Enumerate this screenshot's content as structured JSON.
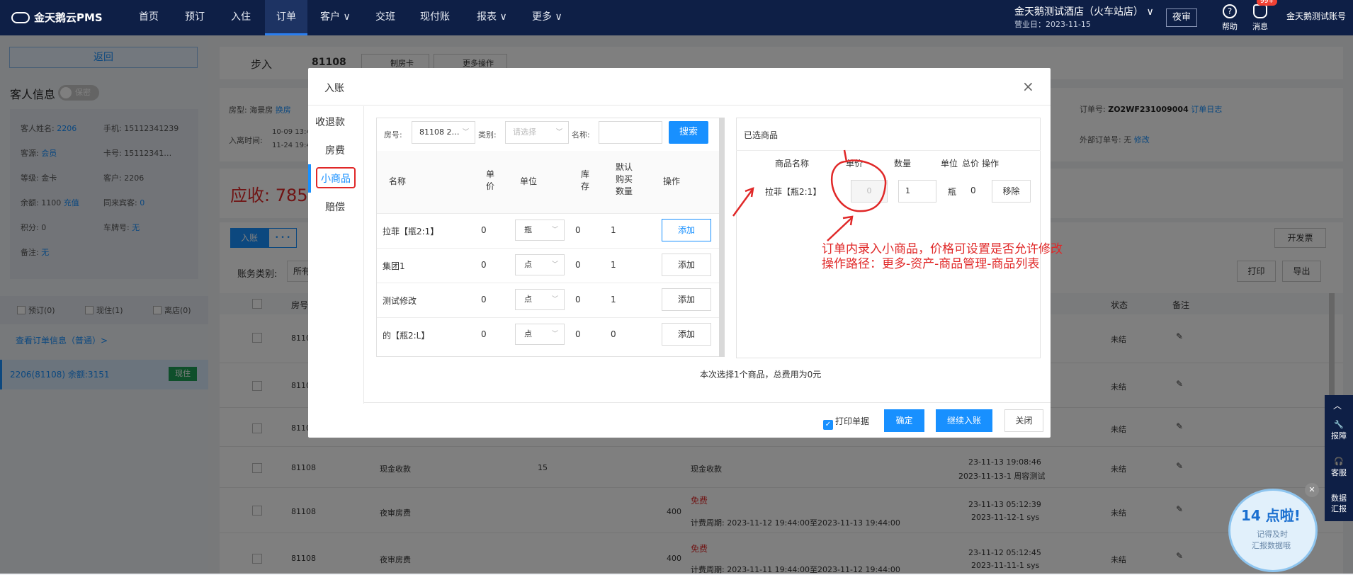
{
  "app": {
    "logo": "金天鹅云PMS",
    "hotel": "金天鹅测试酒店（火车站店）",
    "biz_day": "营业日：2023-11-15",
    "night_audit": "夜审",
    "help": "帮助",
    "messages": "消息",
    "msg_badge": "99+",
    "account": "金天鹅测试账号"
  },
  "nav": [
    {
      "label": "首页"
    },
    {
      "label": "预订"
    },
    {
      "label": "入住"
    },
    {
      "label": "订单"
    },
    {
      "label": "客户 ∨"
    },
    {
      "label": "交班"
    },
    {
      "label": "现付账"
    },
    {
      "label": "报表 ∨"
    },
    {
      "label": "更多 ∨"
    }
  ],
  "left": {
    "back": "返回",
    "guest_title": "客人信息",
    "privacy": "保密",
    "name_label": "客人姓名:",
    "name_value": "2206",
    "phone": "手机: 15112341239",
    "source_label": "客源:",
    "source_value": "会员",
    "card": "卡号: 15112341…",
    "level": "等级: 金卡",
    "customer": "客户: 2206",
    "balance_label": "余额: 1100",
    "recharge": "充值",
    "companions_label": "同来宾客:",
    "companions_value": "0",
    "points": "积分: 0",
    "plate_label": "车牌号:",
    "plate_value": "无",
    "remark_label": "备注:",
    "remark_value": "无",
    "chk_booked": "预订(0)",
    "chk_staying": "现住(1)",
    "chk_left": "离店(0)",
    "view_order": "查看订单信息（普通）>",
    "room_row": "2206(81108)  余额:3151",
    "room_badge": "现住"
  },
  "main": {
    "stepin": "步入",
    "order_no": "81108",
    "make_card": "制房卡",
    "more_ops": "更多操作",
    "room_type": "房型: 海景房",
    "change_room": "换房",
    "stay_time_label": "入离时间:",
    "stay_in": "10-09 13:4",
    "stay_out": "11-24 19:4",
    "order_label": "订单号:",
    "order_value": "ZO2WF231009004",
    "order_log": "订单日志",
    "ext_label": "外部订单号:",
    "ext_value": "无",
    "ext_edit": "修改",
    "receivable": "应收: 785",
    "post_btn": "入账",
    "more_dots": "• • •",
    "invoice": "开发票",
    "print": "打印",
    "export": "导出",
    "acct_type": "账务类别:",
    "acct_value": "所有",
    "col_room": "房号",
    "col_status": "状态",
    "col_remark": "备注"
  },
  "rows": [
    {
      "room": "8110",
      "item": "",
      "amount": "",
      "desc": "",
      "plan": "",
      "time": "",
      "op": "",
      "status": "未结"
    },
    {
      "room": "8110",
      "item": "",
      "amount": "",
      "desc": "",
      "plan": "",
      "time": "",
      "op": "",
      "status": "未结"
    },
    {
      "room": "8110",
      "item": "",
      "amount": "",
      "desc": "",
      "plan": "",
      "time": "",
      "op": "",
      "status": "未结"
    },
    {
      "room": "81108",
      "item": "现金收款",
      "amount": "15",
      "desc": "现金收款",
      "plan": "",
      "time": "23-11-13 19:08:46",
      "op": "2023-11-13-1 周容测试",
      "status": "未结"
    },
    {
      "room": "81108",
      "item": "夜审房费",
      "amount": "400",
      "desc": "免费",
      "plan": "计费周期: 2023-11-12 19:44:00至2023-11-13 19:44:00",
      "time": "23-11-13 05:12:39",
      "op": "2023-11-12-1 sys",
      "status": "未结"
    },
    {
      "room": "81108",
      "item": "夜审房费",
      "amount": "400",
      "desc": "免费",
      "plan": "计费周期: 2023-11-11 19:44:00至2023-11-12 19:44:00",
      "time": "23-11-12 05:12:45",
      "op": "2023-11-11-1 sys",
      "status": "未结"
    }
  ],
  "modal": {
    "title": "入账",
    "tabs": [
      "收退款",
      "房费",
      "小商品",
      "赔偿"
    ],
    "filters": {
      "room_label": "房号:",
      "room_value": "81108 2…",
      "type_label": "类别:",
      "type_placeholder": "请选择",
      "name_label": "名称:",
      "name_value": "",
      "search": "搜索"
    },
    "columns": {
      "name": "名称",
      "price": "单\n价",
      "unit": "单位",
      "stock": "库\n存",
      "default_qty": "默认\n购买\n数量",
      "op": "操作"
    },
    "items": [
      {
        "name": "拉菲【瓶2:1】",
        "price": "0",
        "unit": "瓶",
        "stock": "0",
        "qty": "1",
        "add": "添加"
      },
      {
        "name": "集团1",
        "price": "0",
        "unit": "点",
        "stock": "0",
        "qty": "1",
        "add": "添加"
      },
      {
        "name": "测试修改",
        "price": "0",
        "unit": "点",
        "stock": "0",
        "qty": "1",
        "add": "添加"
      },
      {
        "name": "的【瓶2:L】",
        "price": "0",
        "unit": "点",
        "stock": "0",
        "qty": "0",
        "add": "添加"
      }
    ],
    "selected": {
      "title": "已选商品",
      "col_name": "商品名称",
      "col_price": "单价",
      "col_qty": "数量",
      "col_unit": "单位",
      "col_total": "总价",
      "col_op": "操作",
      "row": {
        "name": "拉菲【瓶2:1】",
        "price": "0",
        "qty": "1",
        "unit": "瓶",
        "total": "0",
        "remove": "移除"
      }
    },
    "summary": "本次选择1个商品，总费用为0元",
    "print_slip": "打印单据",
    "ok": "确定",
    "continue": "继续入账",
    "close": "关闭"
  },
  "annotation": {
    "line1": "订单内录入小商品，价格可设置是否允许修改",
    "line2": "操作路径：更多-资产-商品管理-商品列表"
  },
  "rightbar": {
    "repair": "报障",
    "service": "客服",
    "data": "数据\n汇报"
  },
  "promo": {
    "big": "14 点啦!",
    "line1": "记得及时",
    "line2": "汇报数据哦"
  }
}
